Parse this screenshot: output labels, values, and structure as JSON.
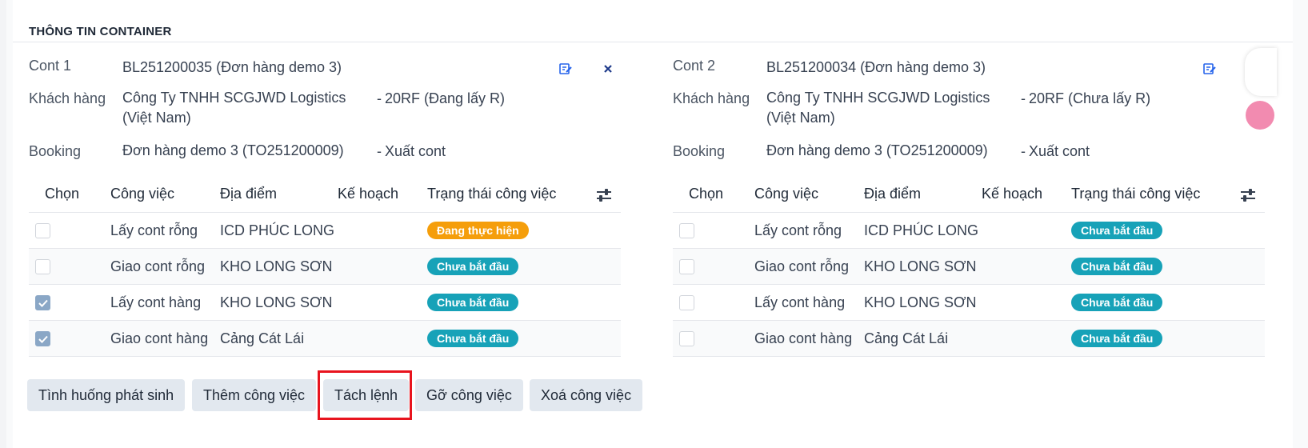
{
  "section": {
    "title": "THÔNG TIN CONTAINER"
  },
  "cards": [
    {
      "label": "Cont 1",
      "bl": "BL251200035 (Đơn hàng demo 3)",
      "customer_label": "Khách hàng",
      "customer": "Công Ty TNHH SCGJWD Logistics (Việt Nam)",
      "container_type": "20RF (Đang lấy R)",
      "booking_label": "Booking",
      "booking": "Đơn hàng demo 3 (TO251200009)",
      "booking_type": "Xuất cont",
      "rows": [
        {
          "checked": false,
          "job": "Lấy cont rỗng",
          "location": "ICD PHÚC LONG",
          "plan": "",
          "status": "Đang thực hiện",
          "status_color": "#f59e0b"
        },
        {
          "checked": false,
          "job": "Giao cont rỗng",
          "location": "KHO LONG SƠN",
          "plan": "",
          "status": "Chưa bắt đầu",
          "status_color": "#17a2b8"
        },
        {
          "checked": true,
          "job": "Lấy cont hàng",
          "location": "KHO LONG SƠN",
          "plan": "",
          "status": "Chưa bắt đầu",
          "status_color": "#17a2b8"
        },
        {
          "checked": true,
          "job": "Giao cont hàng",
          "location": "Cảng Cát Lái",
          "plan": "",
          "status": "Chưa bắt đầu",
          "status_color": "#17a2b8"
        }
      ]
    },
    {
      "label": "Cont 2",
      "bl": "BL251200034 (Đơn hàng demo 3)",
      "customer_label": "Khách hàng",
      "customer": "Công Ty TNHH SCGJWD Logistics (Việt Nam)",
      "container_type": "20RF (Chưa lấy R)",
      "booking_label": "Booking",
      "booking": "Đơn hàng demo 3 (TO251200009)",
      "booking_type": "Xuất cont",
      "rows": [
        {
          "checked": false,
          "job": "Lấy cont rỗng",
          "location": "ICD PHÚC LONG",
          "plan": "",
          "status": "Chưa bắt đầu",
          "status_color": "#17a2b8"
        },
        {
          "checked": false,
          "job": "Giao cont rỗng",
          "location": "KHO LONG SƠN",
          "plan": "",
          "status": "Chưa bắt đầu",
          "status_color": "#17a2b8"
        },
        {
          "checked": false,
          "job": "Lấy cont hàng",
          "location": "KHO LONG SƠN",
          "plan": "",
          "status": "Chưa bắt đầu",
          "status_color": "#17a2b8"
        },
        {
          "checked": false,
          "job": "Giao cont hàng",
          "location": "Cảng Cát Lái",
          "plan": "",
          "status": "Chưa bắt đầu",
          "status_color": "#17a2b8"
        }
      ]
    }
  ],
  "table_headers": {
    "select": "Chọn",
    "job": "Công việc",
    "location": "Địa điểm",
    "plan": "Kế hoạch",
    "status": "Trạng thái công việc"
  },
  "buttons": {
    "incident": "Tình huống phát sinh",
    "add_job": "Thêm công việc",
    "split_order": "Tách lệnh",
    "remove_job": "Gỡ công việc",
    "delete_job": "Xoá công việc"
  },
  "icons": {
    "edit": "edit-icon",
    "close": "close-icon",
    "column_settings": "sliders-icon"
  },
  "colors": {
    "accent": "#17a2b8",
    "warning": "#f59e0b",
    "highlight": "#e8141e",
    "checkbox": "#8aa7c6"
  }
}
